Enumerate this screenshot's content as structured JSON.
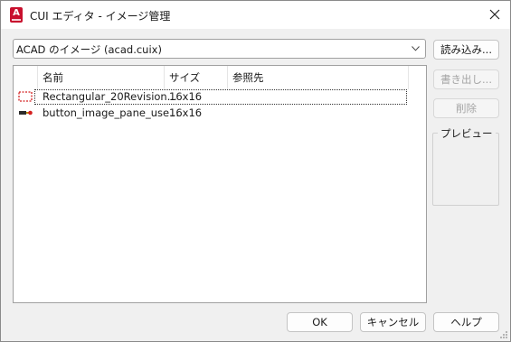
{
  "window": {
    "title": "CUI エディタ - イメージ管理",
    "app_icon_letter": "A"
  },
  "source_combo": {
    "value": "ACAD のイメージ (acad.cuix)"
  },
  "buttons": {
    "load": "読み込み...",
    "export": "書き出し...",
    "delete": "削除",
    "ok": "OK",
    "cancel": "キャンセル",
    "help": "ヘルプ"
  },
  "list": {
    "columns": [
      "",
      "名前",
      "サイズ",
      "参照先"
    ],
    "rows": [
      {
        "icon": "dashed-rectangle-revision-icon",
        "name": "Rectangular_20Revision...",
        "size": "16x16",
        "ref": ""
      },
      {
        "icon": "pane-button-image-icon",
        "name": "button_image_pane_use...",
        "size": "16x16",
        "ref": ""
      }
    ]
  },
  "preview": {
    "label": "プレビュー"
  },
  "colors": {
    "app_icon": "#c8102e",
    "revision_icon": "#d42020"
  }
}
